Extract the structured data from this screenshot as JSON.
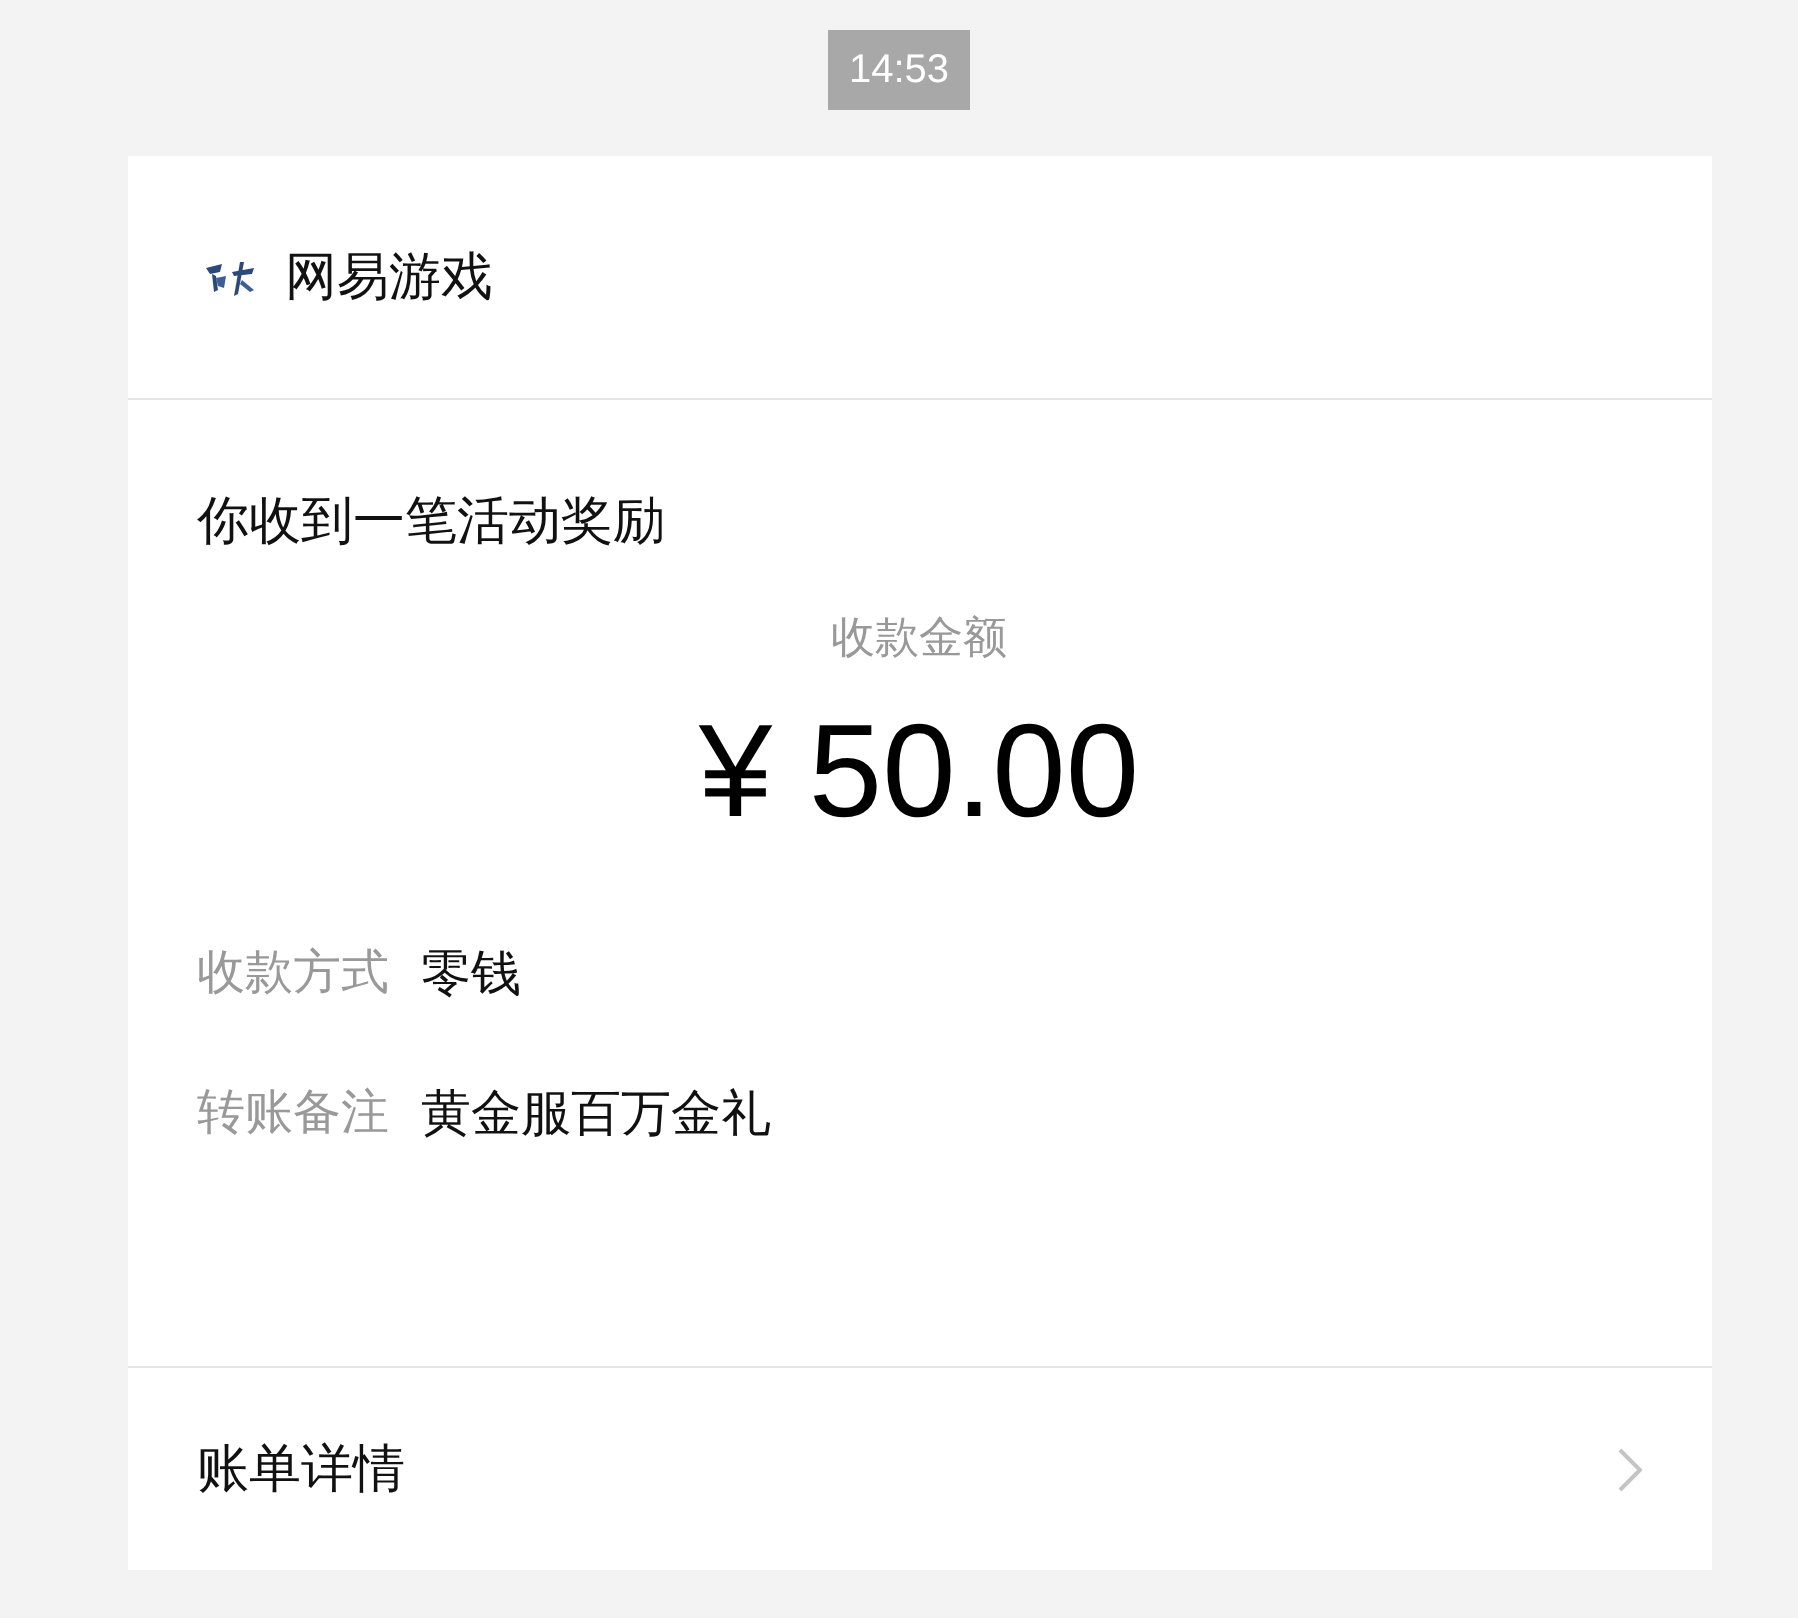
{
  "time": "14:53",
  "header": {
    "sender": "网易游戏"
  },
  "body": {
    "title": "你收到一笔活动奖励",
    "amount_label": "收款金额",
    "amount": "¥ 50.00",
    "fields": [
      {
        "label": "收款方式",
        "value": "零钱"
      },
      {
        "label": "转账备注",
        "value": "黄金服百万金礼"
      }
    ]
  },
  "footer": {
    "link": "账单详情"
  }
}
